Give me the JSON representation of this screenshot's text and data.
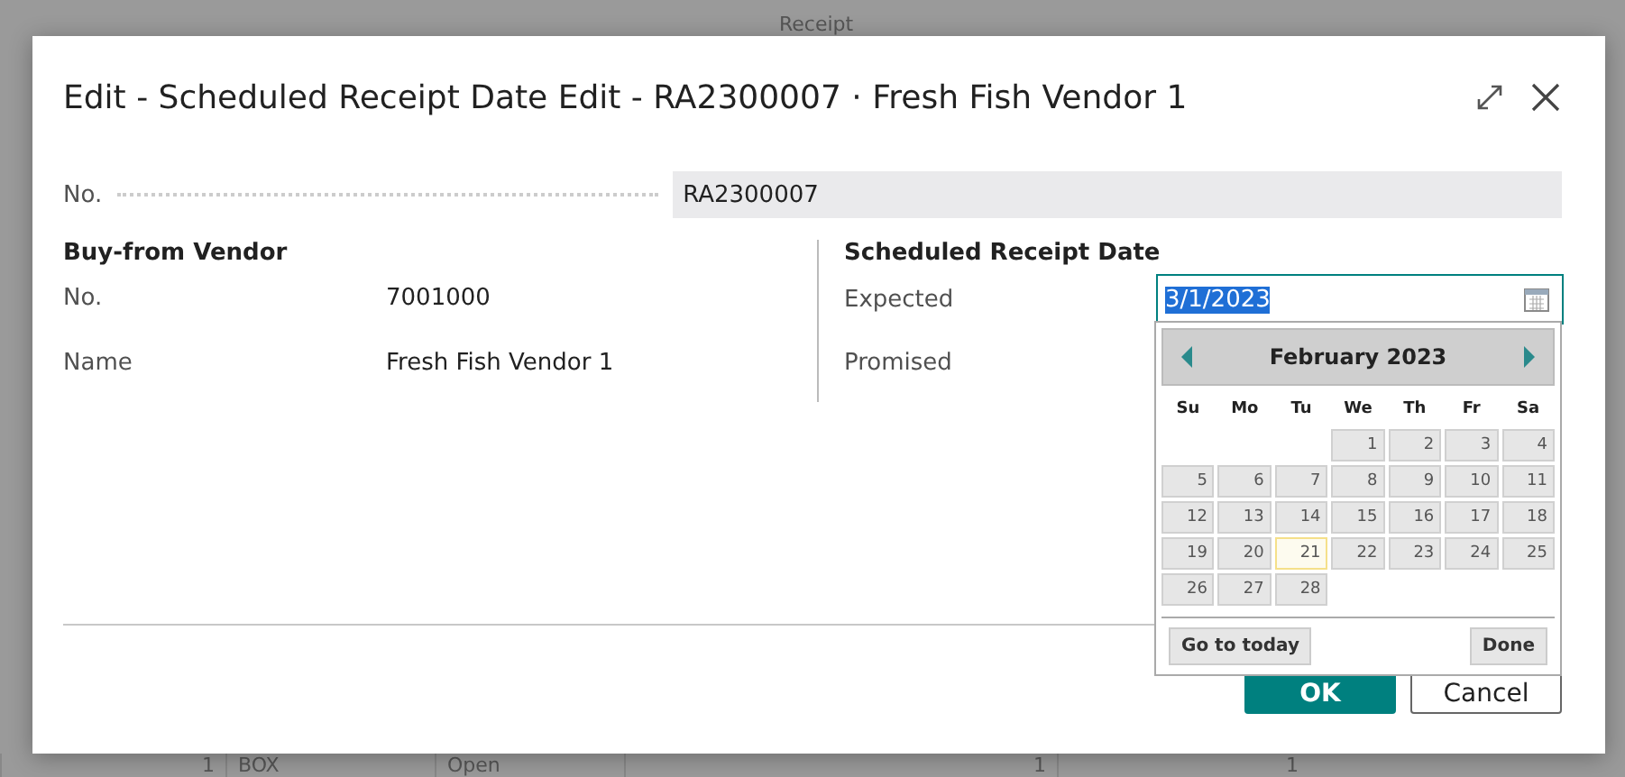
{
  "background": {
    "header": "Receipt",
    "row": [
      "1",
      "BOX",
      "Open",
      "1",
      "1"
    ]
  },
  "dialog": {
    "title": "Edit - Scheduled Receipt Date Edit - RA2300007 · Fresh Fish Vendor 1",
    "no_field": {
      "label": "No.",
      "value": "RA2300007"
    },
    "vendor": {
      "heading": "Buy-from Vendor",
      "fields": [
        {
          "label": "No.",
          "value": "7001000"
        },
        {
          "label": "Name",
          "value": "Fresh Fish Vendor 1"
        }
      ]
    },
    "schedule": {
      "heading": "Scheduled Receipt Date",
      "fields": [
        {
          "label": "Expected",
          "value": "3/1/2023",
          "focused": true,
          "text_selected": true
        },
        {
          "label": "Promised"
        }
      ]
    },
    "buttons": [
      {
        "label": "OK",
        "kind": "primary"
      },
      {
        "label": "Cancel",
        "kind": "secondary"
      }
    ]
  },
  "calendar": {
    "month": "February 2023",
    "weekdays": [
      "Su",
      "Mo",
      "Tu",
      "We",
      "Th",
      "Fr",
      "Sa"
    ],
    "weeks": [
      [
        {
          "day": "1",
          "today": false
        },
        {
          "day": "2",
          "today": false
        },
        {
          "day": "3",
          "today": false
        },
        {
          "day": "4",
          "today": false
        }
      ],
      [
        {
          "day": "5",
          "today": false
        },
        {
          "day": "6",
          "today": false
        },
        {
          "day": "7",
          "today": false
        },
        {
          "day": "8",
          "today": false
        },
        {
          "day": "9",
          "today": false
        },
        {
          "day": "10",
          "today": false
        },
        {
          "day": "11",
          "today": false
        }
      ],
      [
        {
          "day": "12",
          "today": false
        },
        {
          "day": "13",
          "today": false
        },
        {
          "day": "14",
          "today": false
        },
        {
          "day": "15",
          "today": false
        },
        {
          "day": "16",
          "today": false
        },
        {
          "day": "17",
          "today": false
        },
        {
          "day": "18",
          "today": false
        }
      ],
      [
        {
          "day": "19",
          "today": false
        },
        {
          "day": "20",
          "today": false
        },
        {
          "day": "21",
          "today": true
        },
        {
          "day": "22",
          "today": false
        },
        {
          "day": "23",
          "today": false
        },
        {
          "day": "24",
          "today": false
        },
        {
          "day": "25",
          "today": false
        }
      ],
      [
        {
          "day": "26",
          "today": false
        },
        {
          "day": "27",
          "today": false
        },
        {
          "day": "28",
          "today": false
        }
      ]
    ],
    "today_button": "Go to today",
    "done_button": "Done"
  }
}
